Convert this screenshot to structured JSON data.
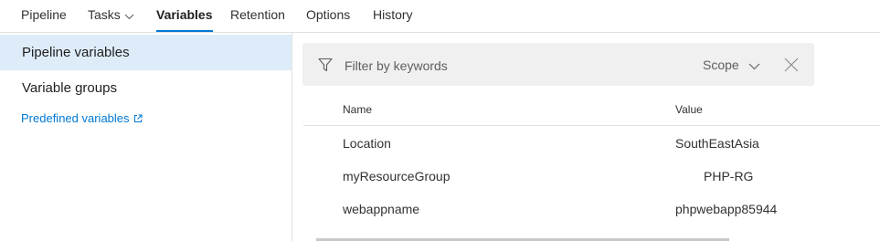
{
  "tabs": [
    {
      "label": "Pipeline"
    },
    {
      "label": "Tasks"
    },
    {
      "label": "Variables"
    },
    {
      "label": "Retention"
    },
    {
      "label": "Options"
    },
    {
      "label": "History"
    }
  ],
  "sidebar": {
    "items": [
      {
        "label": "Pipeline variables"
      },
      {
        "label": "Variable groups"
      }
    ],
    "link": {
      "label": "Predefined variables"
    }
  },
  "filter": {
    "placeholder": "Filter by keywords",
    "scope_label": "Scope"
  },
  "table": {
    "headers": {
      "name": "Name",
      "value": "Value"
    },
    "rows": [
      {
        "name": "Location",
        "value": "SouthEastAsia"
      },
      {
        "name": "myResourceGroup",
        "value": "PHP-RG"
      },
      {
        "name": "webappname",
        "value": "phpwebapp85944"
      }
    ]
  },
  "colors": {
    "accent": "#0078d4",
    "selected_bg": "#deecf9",
    "filter_bg": "#f0f0f0"
  }
}
